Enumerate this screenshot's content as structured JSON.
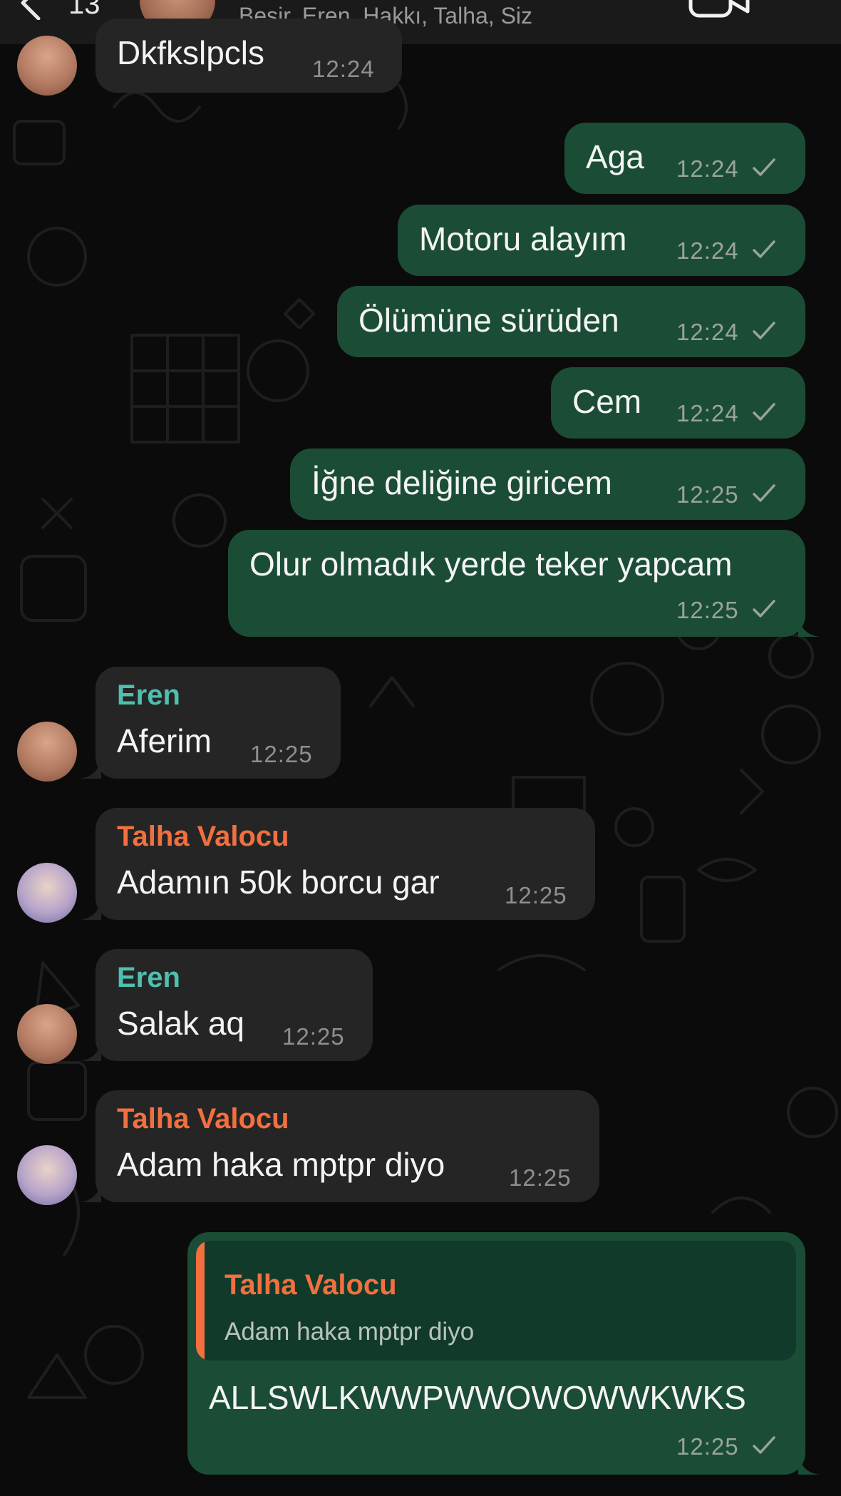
{
  "header": {
    "back_count": "13",
    "subtitle": "Beşir, Eren, Hakkı, Talha, Siz"
  },
  "messages": [
    {
      "text": "Dkfkslpcls",
      "time": "12:24"
    },
    {
      "text": "Aga",
      "time": "12:24"
    },
    {
      "text": "Motoru alayım",
      "time": "12:24"
    },
    {
      "text": "Ölümüne sürüden",
      "time": "12:24"
    },
    {
      "text": "Cem",
      "time": "12:24"
    },
    {
      "text": "İğne deliğine giricem",
      "time": "12:25"
    },
    {
      "text": "Olur olmadık yerde teker yapcam",
      "time": "12:25"
    },
    {
      "sender": "Eren",
      "text": "Aferim",
      "time": "12:25"
    },
    {
      "sender": "Talha Valocu",
      "text": "Adamın 50k borcu gar",
      "time": "12:25"
    },
    {
      "sender": "Eren",
      "text": "Salak aq",
      "time": "12:25"
    },
    {
      "sender": "Talha Valocu",
      "text": "Adam haka mptpr diyo",
      "time": "12:25"
    },
    {
      "quote": {
        "sender": "Talha Valocu",
        "text": "Adam haka mptpr diyo"
      },
      "text": "ALLSWLKWWPWWOWOWWKWKS",
      "time": "12:25"
    }
  ],
  "colors": {
    "outgoing_bubble": "#1b4d36",
    "incoming_bubble": "#252525",
    "sender_eren": "#4fbfb0",
    "sender_talha": "#f2703f"
  },
  "icons": [
    "back-chevron-icon",
    "video-call-icon",
    "read-check-icon"
  ]
}
